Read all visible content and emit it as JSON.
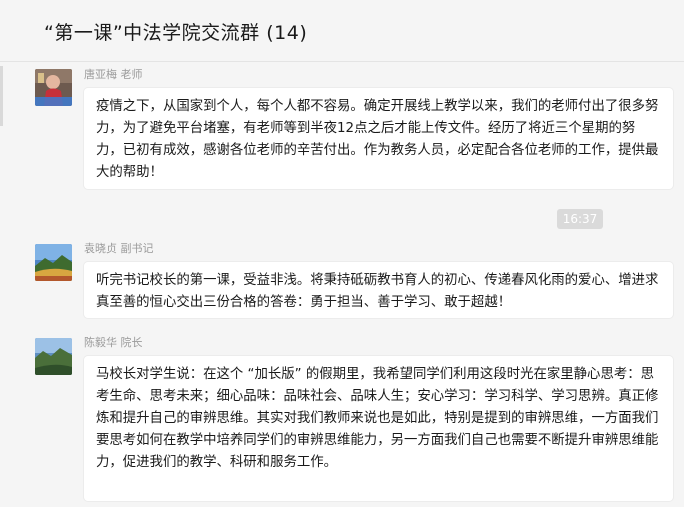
{
  "chat": {
    "title": "“第一课”中法学院交流群 (14)"
  },
  "time_divider": "16:37",
  "messages": [
    {
      "sender": "唐亚梅 老师",
      "avatar": "avatar-photo",
      "text": "疫情之下，从国家到个人，每个人都不容易。确定开展线上教学以来，我们的老师付出了很多努力，为了避免平台堵塞，有老师等到半夜12点之后才能上传文件。经历了将近三个星期的努力，已初有成效，感谢各位老师的辛苦付出。作为教务人员，必定配合各位老师的工作，提供最大的帮助！"
    },
    {
      "sender": "袁晓贞 副书记",
      "avatar": "avatar-landscape",
      "text": "听完书记校长的第一课，受益非浅。将秉持砥砺教书育人的初心、传递春风化雨的爱心、增进求真至善的恒心交出三份合格的答卷：勇于担当、善于学习、敢于超越！"
    },
    {
      "sender": "陈毅华 院长",
      "avatar": "avatar-landscape",
      "text": "马校长对学生说：在这个 “加长版” 的假期里，我希望同学们利用这段时光在家里静心思考：思考生命、思考未来；细心品味：品味社会、品味人生；安心学习：学习科学、学习思辨。真正修炼和提升自己的审辨思维。其实对我们教师来说也是如此，特别是提到的审辨思维，一方面我们要思考如何在教学中培养同学们的审辨思维能力，另一方面我们自己也需要不断提升审辨思维能力，促进我们的教学、科研和服务工作。"
    }
  ]
}
